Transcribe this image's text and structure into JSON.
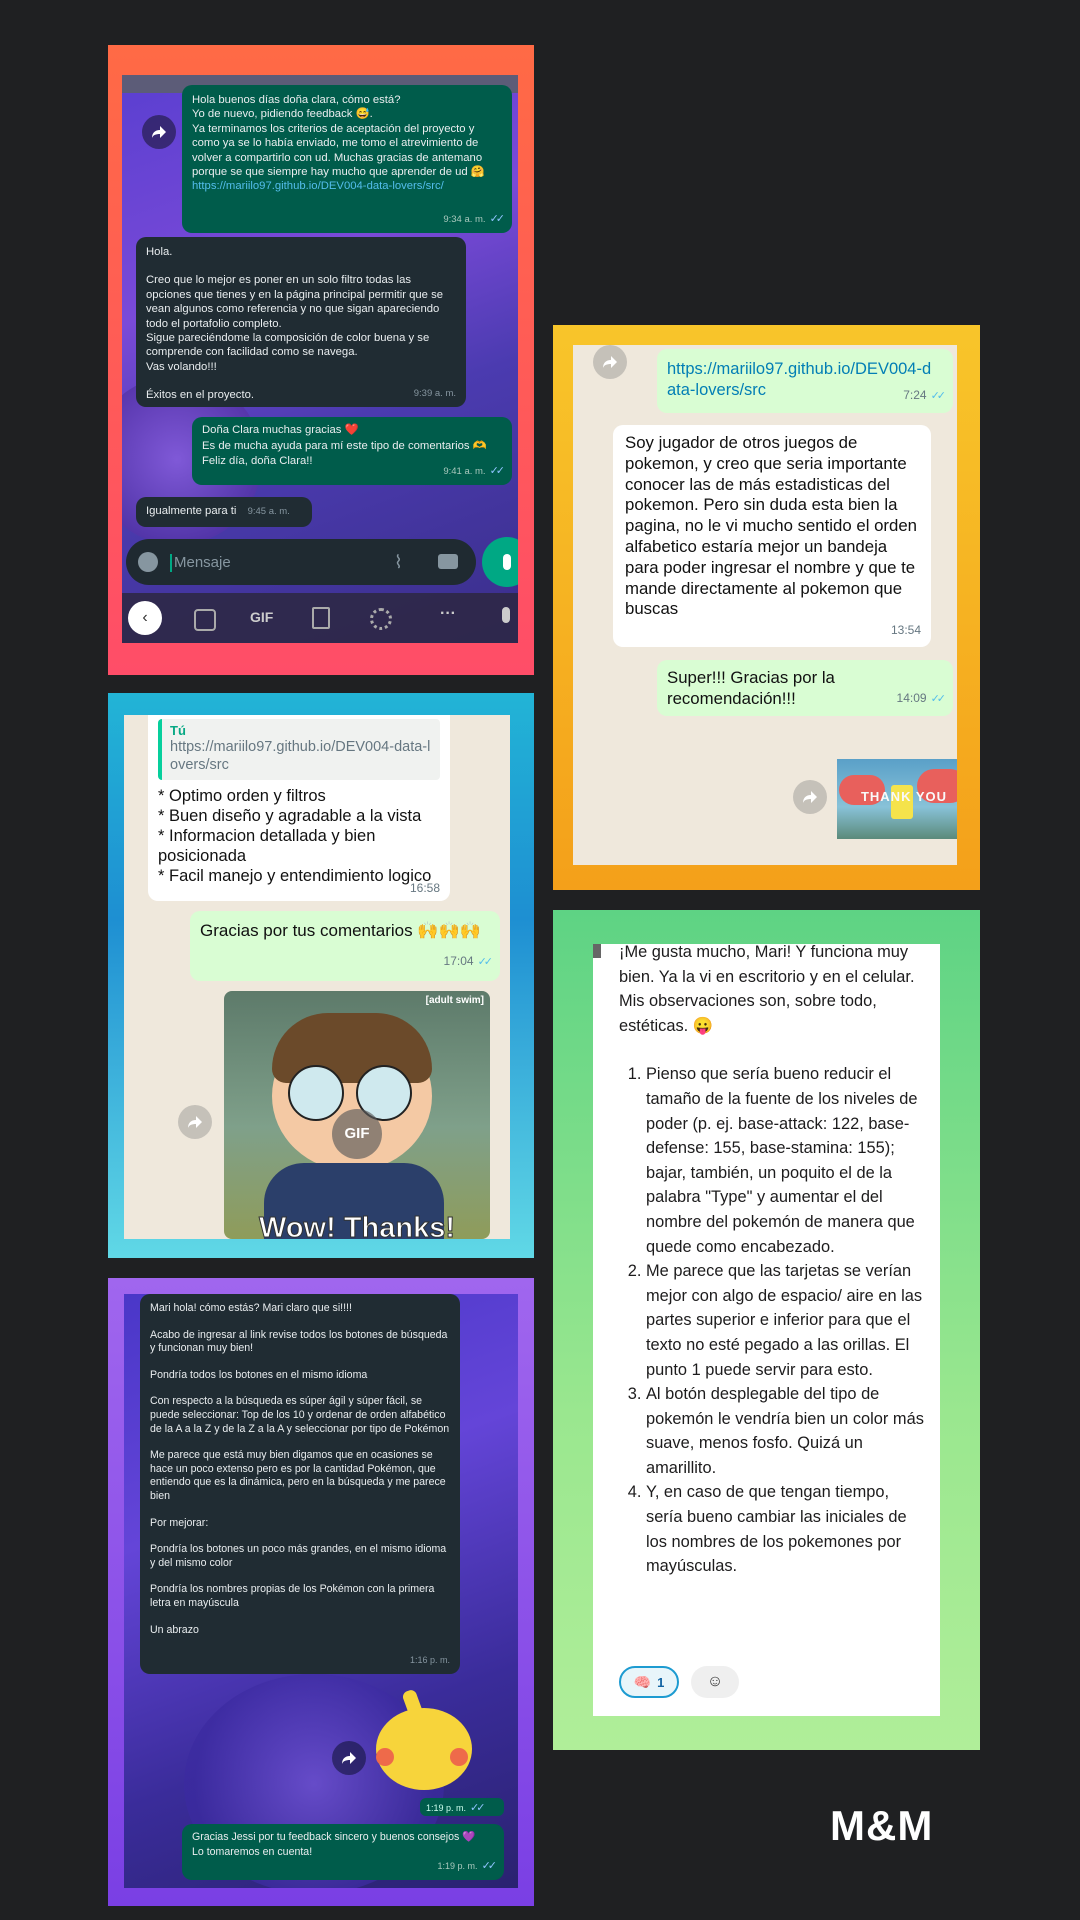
{
  "colors": {
    "background": "#1f2022",
    "card1_gradient": [
      "#ff6f45",
      "#ff4a6a"
    ],
    "card2_gradient": [
      "#f9c72a",
      "#f5a11a"
    ],
    "card3_gradient": [
      "#6fe0e8",
      "#1c8fd0"
    ],
    "card4_gradient": [
      "#a66bf0",
      "#7b3fe4"
    ],
    "card5_gradient": [
      "#5ed384",
      "#a8ec8f"
    ],
    "dark_outgoing": "#005c4b",
    "dark_incoming": "#202c33",
    "light_outgoing": "#d9fdd3",
    "light_incoming": "#ffffff",
    "link": "#53bdeb"
  },
  "chat1": {
    "msg1": {
      "lines": [
        "Hola buenos días doña clara, cómo está?",
        "Yo de nuevo, pidiendo feedback 😅.",
        "Ya terminamos los criterios de aceptación del proyecto y como ya se lo había enviado, me tomo el atrevimiento de volver a compartirlo con ud. Muchas gracias de antemano porque se que siempre hay mucho que aprender de ud 🤗"
      ],
      "link": "https://mariilo97.github.io/DEV004-data-lovers/src/",
      "time": "9:34 a. m."
    },
    "msg2": {
      "lines": [
        "Hola.",
        "",
        "Creo que lo mejor es poner en un solo filtro todas las opciones que tienes y en la página principal permitir que se vean algunos como referencia y no que sigan apareciendo todo el portafolio completo.",
        "Sigue pareciéndome la composición de color buena y se comprende con facilidad como se navega.",
        "Vas volando!!!",
        "",
        "Éxitos en el proyecto."
      ],
      "time": "9:39 a. m."
    },
    "msg3": {
      "lines": [
        "Doña Clara muchas gracias ❤️",
        "Es de mucha ayuda para mí este tipo de comentarios 🫶",
        "Feliz día, doña Clara!!"
      ],
      "time": "9:41 a. m."
    },
    "msg4": {
      "text": "Igualmente para ti",
      "time": "9:45 a. m."
    },
    "input_placeholder": "Mensaje",
    "keyboard": {
      "gif": "GIF",
      "more": "···"
    }
  },
  "chat2": {
    "link_msg": {
      "text": "https://mariilo97.github.io/DEV004-data-lovers/src",
      "time": "7:24"
    },
    "incoming": {
      "text": "Soy jugador de otros juegos de pokemon, y creo que seria importante conocer las de más estadisticas del pokemon. Pero sin duda esta bien la pagina,  no le vi mucho sentido el orden alfabetico estaría mejor un bandeja para poder ingresar el nombre y que te mande directamente al pokemon que buscas",
      "time": "13:54"
    },
    "reply": {
      "text": "Super!!! Gracias por la recomendación!!!",
      "time": "14:09"
    },
    "sticker_text": "THANK YOU"
  },
  "chat3": {
    "quote_author": "Tú",
    "quote_text": "https://mariilo97.github.io/DEV004-data-lovers/src",
    "lines": [
      "* Optimo orden y filtros",
      "* Buen diseño y agradable a la vista",
      "* Informacion detallada y bien posicionada",
      "* Facil manejo y entendimiento logico"
    ],
    "time": "16:58",
    "reply": {
      "text": "Gracias por tus comentarios 🙌🙌🙌",
      "time": "17:04"
    },
    "gif": {
      "watermark": "[adult swim]",
      "badge": "GIF",
      "caption": "Wow! Thanks!"
    }
  },
  "chat4": {
    "incoming": {
      "paragraphs": [
        "Mari hola!  cómo estás? Mari claro que si!!!!",
        "Acabo de ingresar al link revise todos los botones de búsqueda y funcionan muy bien!",
        "Pondría todos los botones en el mismo idioma",
        "Con respecto a la búsqueda es súper ágil y súper fácil, se puede seleccionar: Top de los 10 y ordenar de orden alfabético de la A a la Z y de la Z a la A y seleccionar por tipo de Pokémon",
        "Me parece que está muy bien digamos que en ocasiones se hace un poco extenso pero es por la cantidad Pokémon, que entiendo que es la dinámica, pero en la búsqueda y me parece bien",
        "Por mejorar:",
        "Pondría los botones un poco más grandes, en el mismo idioma y del mismo color",
        "Pondría los nombres propias de los Pokémon con la primera letra en mayúscula",
        "Un abrazo"
      ],
      "time": "1:16 p. m."
    },
    "sticker_time": "1:19 p. m.",
    "reply": {
      "lines": [
        "Gracias Jessi por tu feedback sincero y buenos consejos 💜",
        "Lo tomaremos en cuenta!"
      ],
      "time": "1:19 p. m."
    }
  },
  "chat5": {
    "intro": "¡Me gusta mucho, Mari! Y funciona muy bien. Ya la vi en escritorio y en el celular. Mis observaciones son, sobre todo, estéticas. 😛",
    "items": [
      "Pienso que sería bueno reducir el tamaño de la fuente de los niveles de poder (p. ej. base-attack: 122, base-defense: 155, base-stamina: 155); bajar, también, un poquito el de la palabra \"Type\" y aumentar el del nombre del pokemón de manera que quede como encabezado.",
      "Me parece que las tarjetas se verían mejor con algo de espacio/ aire en las partes superior e inferior para que el texto no esté pegado a las orillas. El punto 1 puede servir para esto.",
      "Al botón desplegable del tipo de pokemón le vendría bien un color más suave, menos fosfo. Quizá un amarillito.",
      "Y, en caso de que tengan tiempo, sería bueno cambiar las iniciales de los nombres de los pokemones por mayúsculas."
    ],
    "reaction_emoji": "🧠",
    "reaction_count": "1"
  },
  "brand": {
    "logo": "M&M"
  }
}
